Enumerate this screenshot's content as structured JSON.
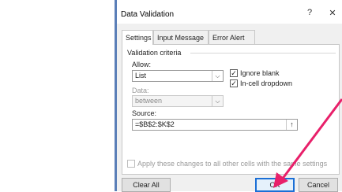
{
  "dialog": {
    "title": "Data Validation",
    "help": "?",
    "close": "✕"
  },
  "tabs": [
    {
      "label": "Settings",
      "active": true
    },
    {
      "label": "Input Message",
      "active": false
    },
    {
      "label": "Error Alert",
      "active": false
    }
  ],
  "settings": {
    "group_label": "Validation criteria",
    "allow_label": "Allow:",
    "allow_value": "List",
    "ignore_blank_label": "Ignore blank",
    "ignore_blank_checked": true,
    "in_cell_dropdown_label": "In-cell dropdown",
    "in_cell_dropdown_checked": true,
    "data_label": "Data:",
    "data_value": "between",
    "source_label": "Source:",
    "source_value": "=$B$2:$K$2",
    "apply_all_label": "Apply these changes to all other cells with the same settings",
    "apply_all_checked": false
  },
  "buttons": {
    "clear_all": "Clear All",
    "ok": "OK",
    "cancel": "Cancel"
  },
  "annotation": {
    "arrow_color": "#e8206a"
  }
}
